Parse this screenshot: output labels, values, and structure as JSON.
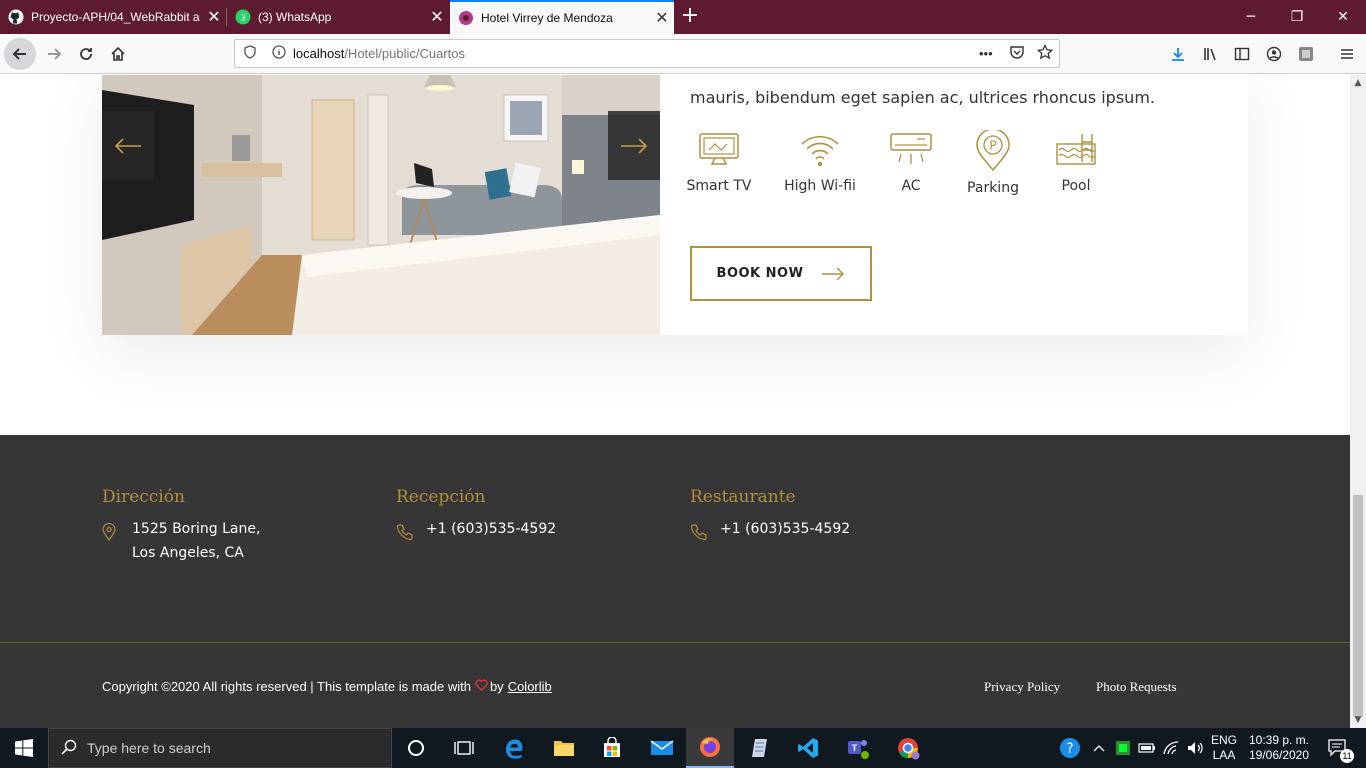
{
  "browser": {
    "tabs": [
      {
        "title": "Proyecto-APH/04_WebRabbit a",
        "icon": "github-icon"
      },
      {
        "title": "(3) WhatsApp",
        "icon": "whatsapp-icon"
      },
      {
        "title": "Hotel Virrey de Mendoza",
        "icon": "firefox-page-icon",
        "active": true
      }
    ],
    "url_host": "localhost",
    "url_path": "/Hotel/public/Cuartos",
    "more_label": "•••"
  },
  "room": {
    "description": "mauris, bibendum eget sapien ac, ultrices rhoncus ipsum.",
    "amenities": [
      {
        "label": "Smart TV",
        "icon": "smart-tv-icon"
      },
      {
        "label": "High Wi-fii",
        "icon": "wifi-icon"
      },
      {
        "label": "AC",
        "icon": "air-conditioner-icon"
      },
      {
        "label": "Parking",
        "icon": "parking-icon"
      },
      {
        "label": "Pool",
        "icon": "pool-icon"
      }
    ],
    "book_label": "BOOK NOW",
    "accent": "#b1903e"
  },
  "footer": {
    "direccion_title": "Dirección",
    "direccion_line1": "1525 Boring Lane,",
    "direccion_line2": "Los Angeles, CA",
    "recepcion_title": "Recepción",
    "recepcion_phone": "+1 (603)535-4592",
    "restaurante_title": "Restaurante",
    "restaurante_phone": "+1 (603)535-4592",
    "copyright_text": "Copyright ©2020 All rights reserved | This template is made with",
    "copyright_by": "by",
    "colorlib": "Colorlib",
    "privacy": "Privacy Policy",
    "photo_requests": "Photo Requests",
    "bg": "#363636"
  },
  "taskbar": {
    "search_placeholder": "Type here to search",
    "lang1": "ENG",
    "lang2": "LAA",
    "time": "10:39 p. m.",
    "date": "19/06/2020",
    "notif_count": "11"
  }
}
